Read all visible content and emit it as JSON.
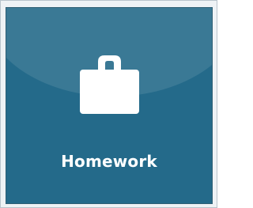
{
  "tile": {
    "label": "Homework",
    "icon": "briefcase-icon",
    "background_color": "#246a8a",
    "icon_color": "#ffffff"
  }
}
